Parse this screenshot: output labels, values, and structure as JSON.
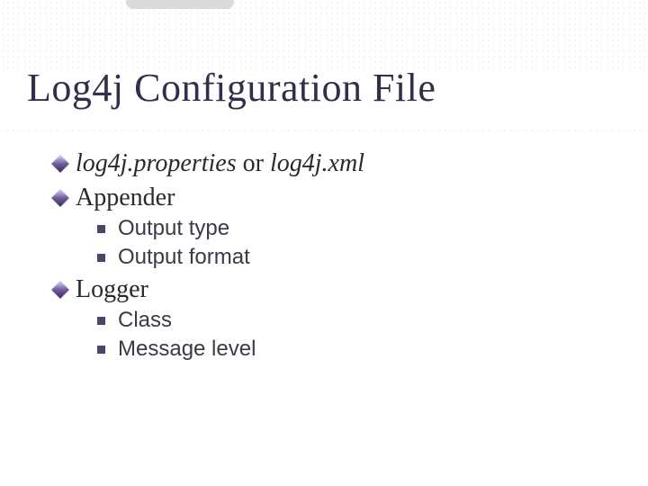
{
  "title": "Log4j Configuration File",
  "bullets": [
    {
      "parts": [
        "log4j.properties",
        " or ",
        "log4j.xml"
      ]
    },
    {
      "label": "Appender",
      "children": [
        "Output type",
        "Output format"
      ]
    },
    {
      "label": "Logger",
      "children": [
        "Class",
        "Message level"
      ]
    }
  ]
}
